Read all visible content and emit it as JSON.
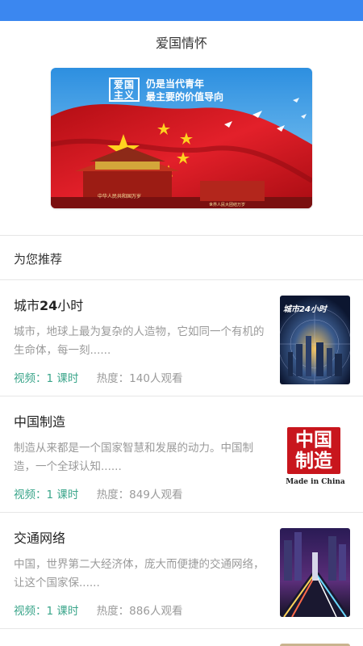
{
  "header": {
    "title": "爱国情怀"
  },
  "banner": {
    "badge_line1": "爱国",
    "badge_line2": "主义",
    "slogan_line1": "仍是当代青年",
    "slogan_line2": "最主要的价值导向",
    "gate_sign": "中华人民共和国万岁",
    "gate_sign2": "世界人民大团结万岁"
  },
  "recommend": {
    "title": "为您推荐"
  },
  "courses": [
    {
      "title_a": "城市",
      "title_b": "24",
      "title_c": "小时",
      "desc": "城市，地球上最为复杂的人造物，它如同一个有机的生命体，每一刻......",
      "video": "视频：1 课时",
      "hot": "热度：140人观看",
      "thumb_text": "城市24小时"
    },
    {
      "title_a": "中国制造",
      "title_b": "",
      "title_c": "",
      "desc": "制造从来都是一个国家智慧和发展的动力。中国制造，一个全球认知......",
      "video": "视频：1 课时",
      "hot": "热度：849人观看",
      "thumb_text": "中国制造",
      "thumb_caption": "Made in China"
    },
    {
      "title_a": "交通网络",
      "title_b": "",
      "title_c": "",
      "desc": "中国，世界第二大经济体，庞大而便捷的交通网络，让这个国家保......",
      "video": "视频：1 课时",
      "hot": "热度：886人观看"
    }
  ],
  "colors": {
    "statusbar": "#3b87f0",
    "accent_green": "#3aa58a",
    "muted": "#9a9a9a",
    "flag_red": "#d8141d"
  }
}
